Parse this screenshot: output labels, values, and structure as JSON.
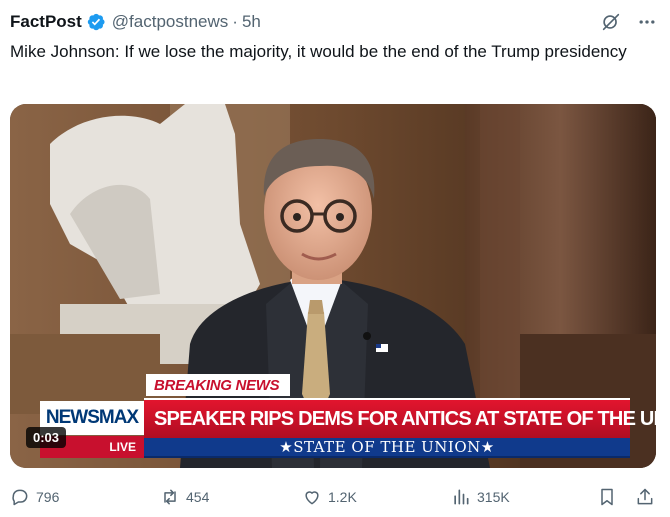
{
  "post": {
    "display_name": "FactPost",
    "handle": "@factpostnews",
    "separator": "·",
    "time": "5h",
    "text": "Mike Johnson: If we lose the majority, it would be the end of the Trump presidency"
  },
  "media": {
    "type": "video",
    "timer": "0:03",
    "overlay": {
      "breaking": "BREAKING NEWS",
      "brand": "NEWSMAX",
      "headline": "SPEAKER RIPS DEMS FOR ANTICS AT STATE OF THE UNION",
      "live": "LIVE",
      "bar": "★STATE OF THE UNION★"
    }
  },
  "actions": {
    "replies": "796",
    "reposts": "454",
    "likes": "1.2K",
    "views": "315K"
  },
  "icons": {
    "verified": "verified-badge-icon",
    "grok": "grok-icon",
    "more": "more-icon",
    "reply": "reply-icon",
    "repost": "repost-icon",
    "like": "like-icon",
    "views": "views-icon",
    "bookmark": "bookmark-icon",
    "share": "share-icon"
  },
  "colors": {
    "verified": "#1d9bf0",
    "text": "#0f1419",
    "secondary": "#536471",
    "breaking_red": "#c8102e",
    "newsmax_blue": "#003876",
    "banner_blue": "#103a8c"
  }
}
